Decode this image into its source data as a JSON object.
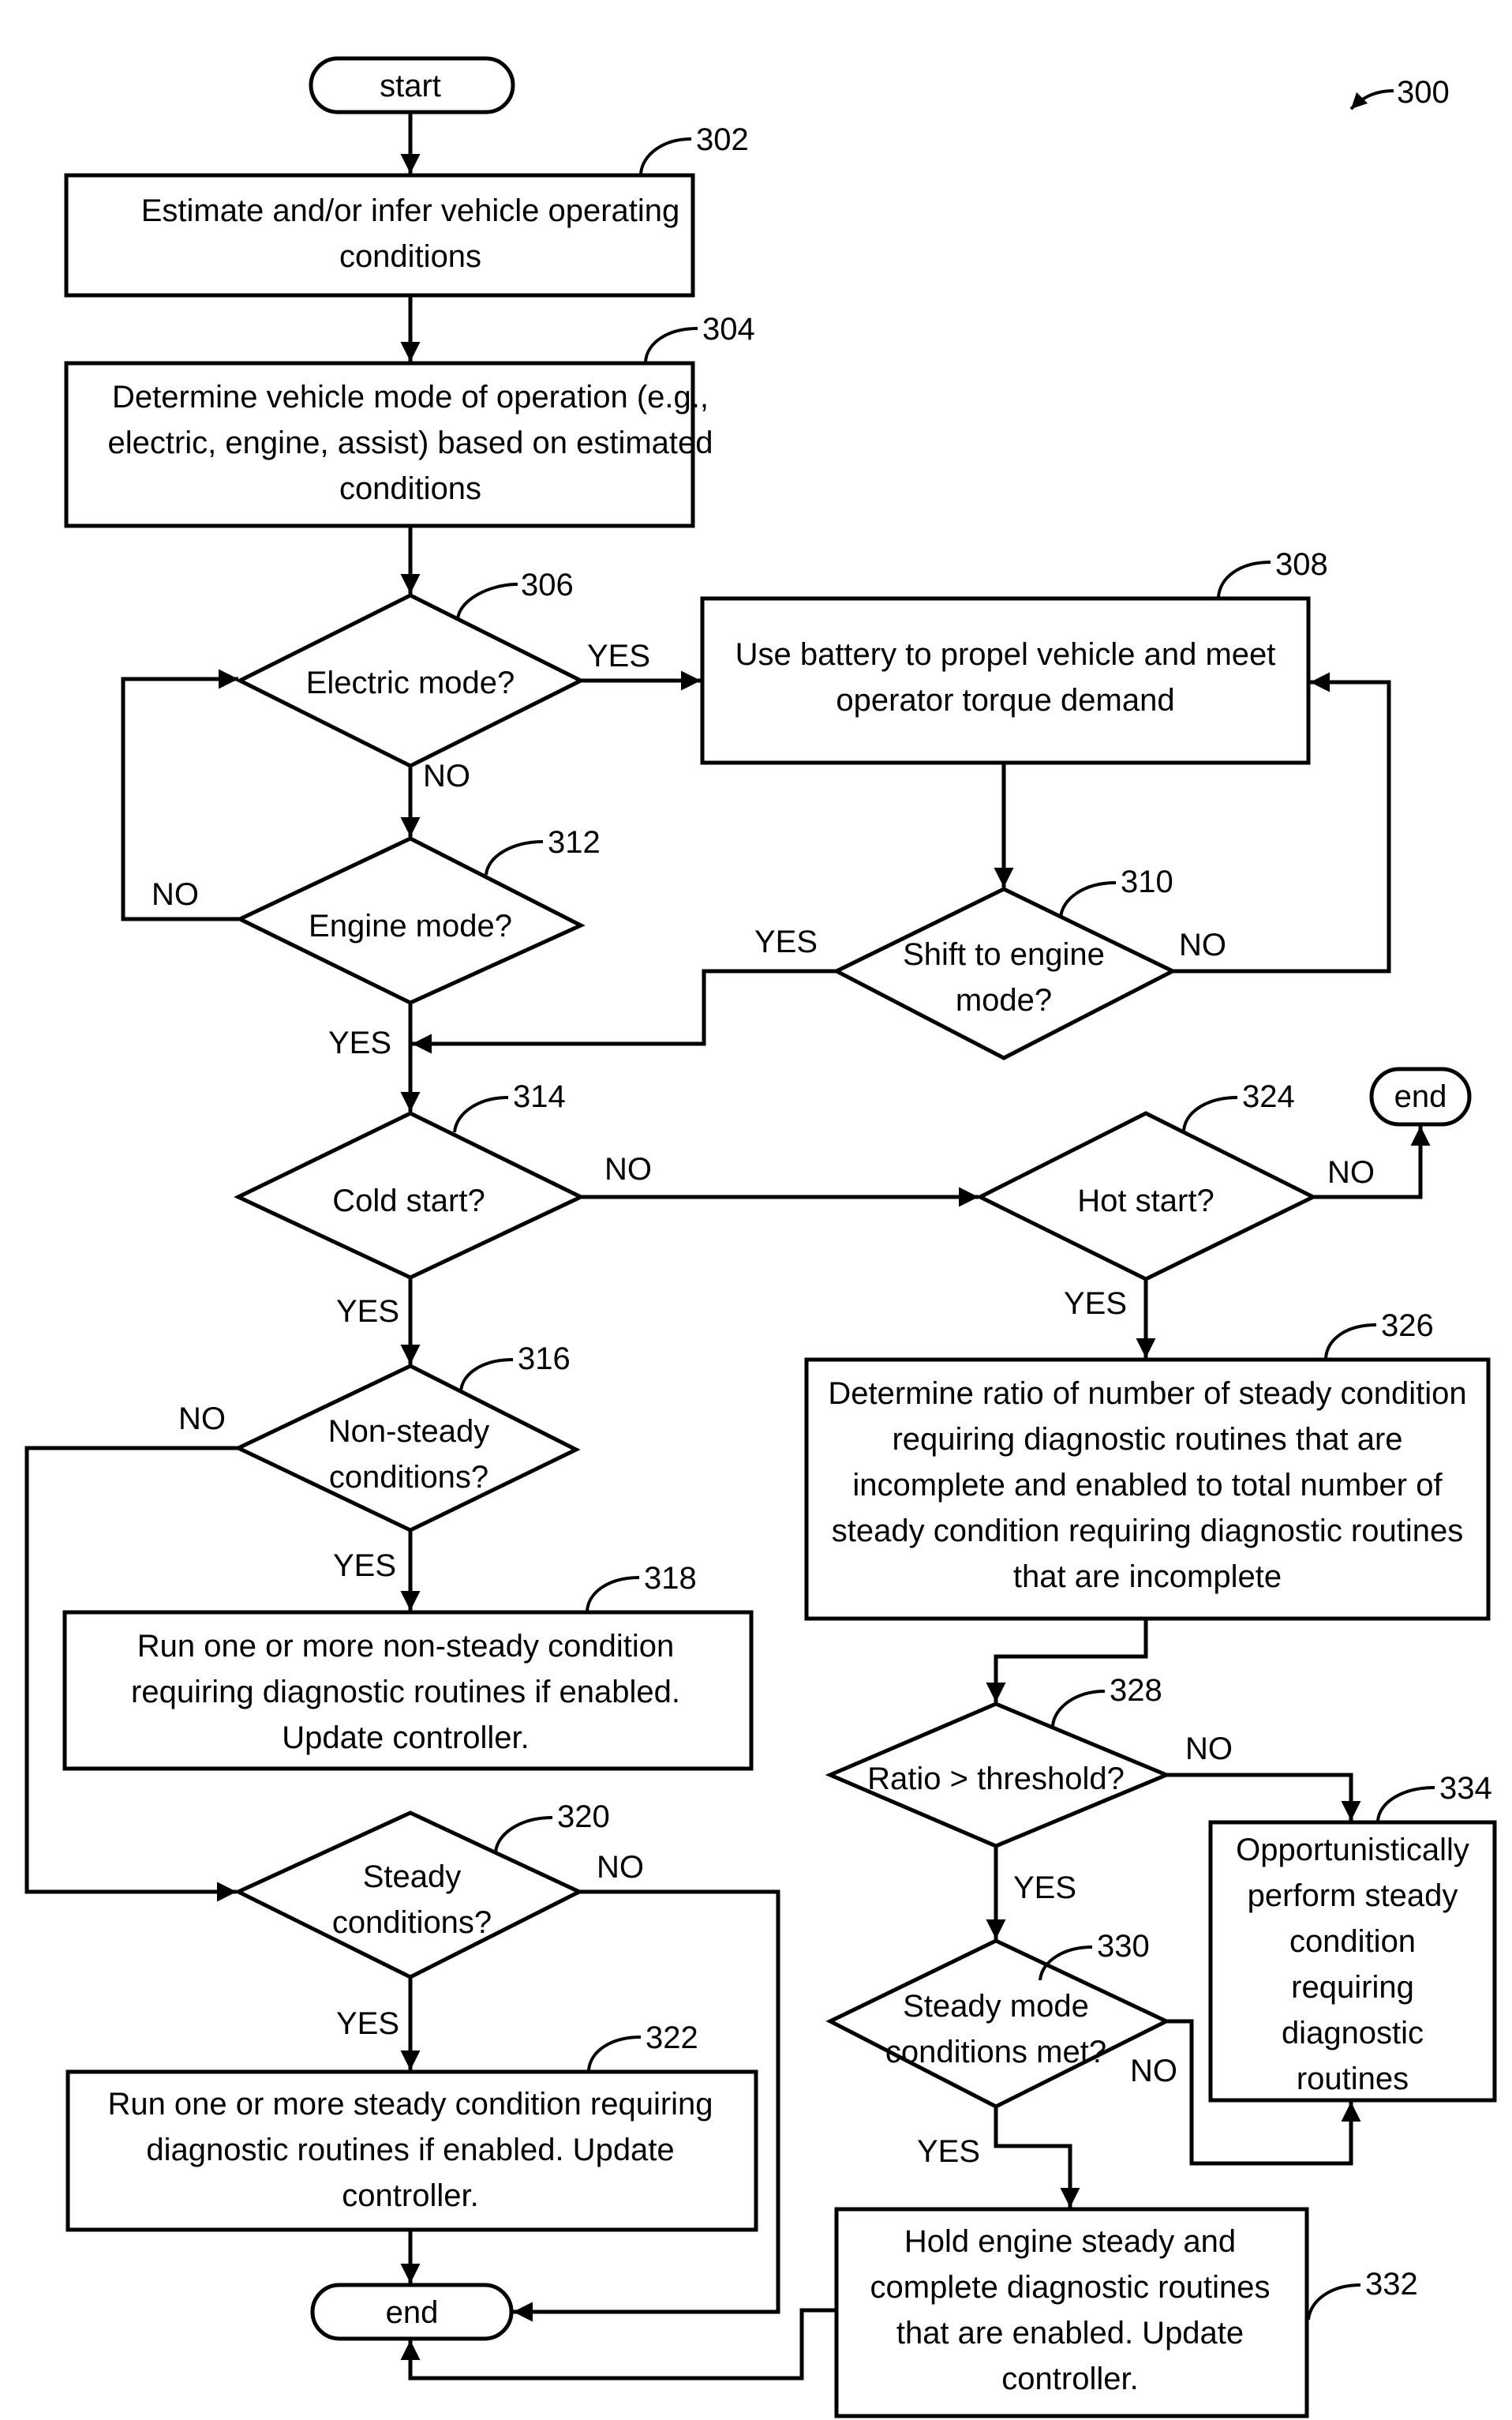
{
  "figure": {
    "ref": "300",
    "nodes": {
      "start": {
        "ref": "",
        "lines": [
          "start"
        ]
      },
      "n302": {
        "ref": "302",
        "lines": [
          "Estimate and/or infer vehicle operating",
          "conditions"
        ]
      },
      "n304": {
        "ref": "304",
        "lines": [
          "Determine vehicle mode of operation (e.g.,",
          "electric, engine, assist) based on estimated",
          "conditions"
        ]
      },
      "n306": {
        "ref": "306",
        "lines": [
          "Electric mode?"
        ]
      },
      "n308": {
        "ref": "308",
        "lines": [
          "Use battery to propel vehicle and meet",
          "operator torque demand"
        ]
      },
      "n310": {
        "ref": "310",
        "lines": [
          "Shift to engine",
          "mode?"
        ]
      },
      "n312": {
        "ref": "312",
        "lines": [
          "Engine mode?"
        ]
      },
      "n314": {
        "ref": "314",
        "lines": [
          "Cold start?"
        ]
      },
      "n316": {
        "ref": "316",
        "lines": [
          "Non-steady",
          "conditions?"
        ]
      },
      "n318": {
        "ref": "318",
        "lines": [
          "Run one or more non-steady condition",
          "requiring diagnostic routines if enabled.",
          "Update controller."
        ]
      },
      "n320": {
        "ref": "320",
        "lines": [
          "Steady",
          "conditions?"
        ]
      },
      "n322": {
        "ref": "322",
        "lines": [
          "Run one or more steady condition requiring",
          "diagnostic routines if enabled. Update",
          "controller."
        ]
      },
      "n324": {
        "ref": "324",
        "lines": [
          "Hot start?"
        ]
      },
      "end_top": {
        "ref": "",
        "lines": [
          "end"
        ]
      },
      "n326": {
        "ref": "326",
        "lines": [
          "Determine ratio of number of steady condition",
          "requiring diagnostic routines that are",
          "incomplete and enabled to total number of",
          "steady condition requiring diagnostic routines",
          "that are incomplete"
        ]
      },
      "n328": {
        "ref": "328",
        "lines": [
          "Ratio > threshold?"
        ]
      },
      "n330": {
        "ref": "330",
        "lines": [
          "Steady mode",
          "conditions met?"
        ]
      },
      "n332": {
        "ref": "332",
        "lines": [
          "Hold engine steady and",
          "complete diagnostic routines",
          "that are enabled. Update",
          "controller."
        ]
      },
      "n334": {
        "ref": "334",
        "lines": [
          "Opportunistically",
          "perform steady",
          "condition",
          "requiring",
          "diagnostic",
          "routines"
        ]
      },
      "end_bottom": {
        "ref": "",
        "lines": [
          "end"
        ]
      }
    },
    "edge_labels": {
      "e306_yes": "YES",
      "e306_no": "NO",
      "e312_no": "NO",
      "e312_yes": "YES",
      "e310_yes": "YES",
      "e310_no": "NO",
      "e314_no": "NO",
      "e314_yes": "YES",
      "e324_no": "NO",
      "e324_yes": "YES",
      "e316_no": "NO",
      "e316_yes": "YES",
      "e320_no": "NO",
      "e320_yes": "YES",
      "e328_no": "NO",
      "e328_yes": "YES",
      "e330_no": "NO",
      "e330_yes": "YES"
    }
  }
}
